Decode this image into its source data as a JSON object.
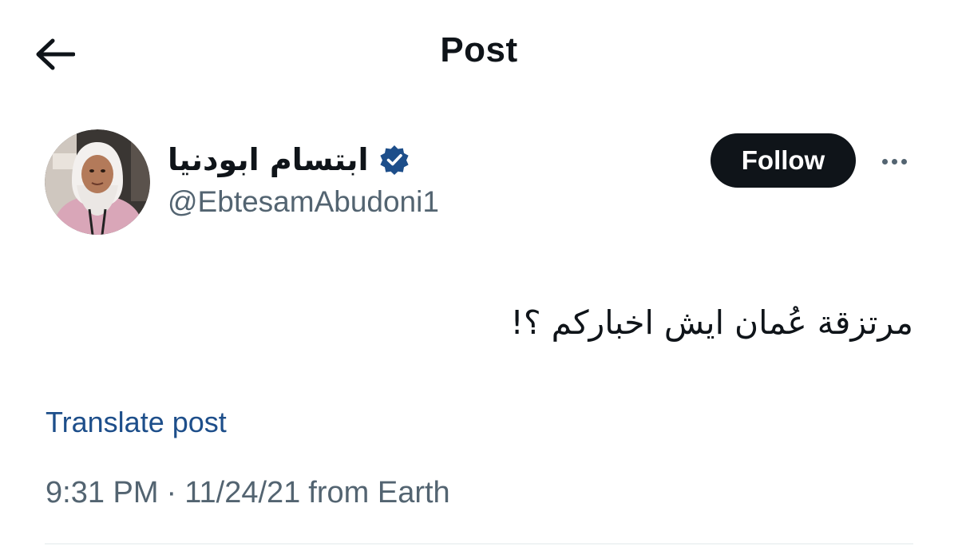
{
  "header": {
    "title": "Post",
    "back_icon": "arrow-left-icon"
  },
  "author": {
    "display_name": "ابتسام ابودنيا",
    "handle": "@EbtesamAbudoni1",
    "verified_icon": "verified-badge-icon",
    "verified_color": "#1d4e8a",
    "avatar_icon": "profile-photo"
  },
  "actions": {
    "follow_label": "Follow",
    "more_icon": "more-horizontal-icon"
  },
  "post": {
    "text": "مرتزقة عُمان ايش اخباركم ؟!",
    "translate_label": "Translate post"
  },
  "meta": {
    "time": "9:31 PM",
    "separator": "·",
    "date": "11/24/21",
    "source": "from Earth"
  },
  "colors": {
    "text_primary": "#0f1419",
    "text_secondary": "#536471",
    "link": "#1d4e8a",
    "follow_bg": "#0f1419",
    "background": "#ffffff"
  }
}
